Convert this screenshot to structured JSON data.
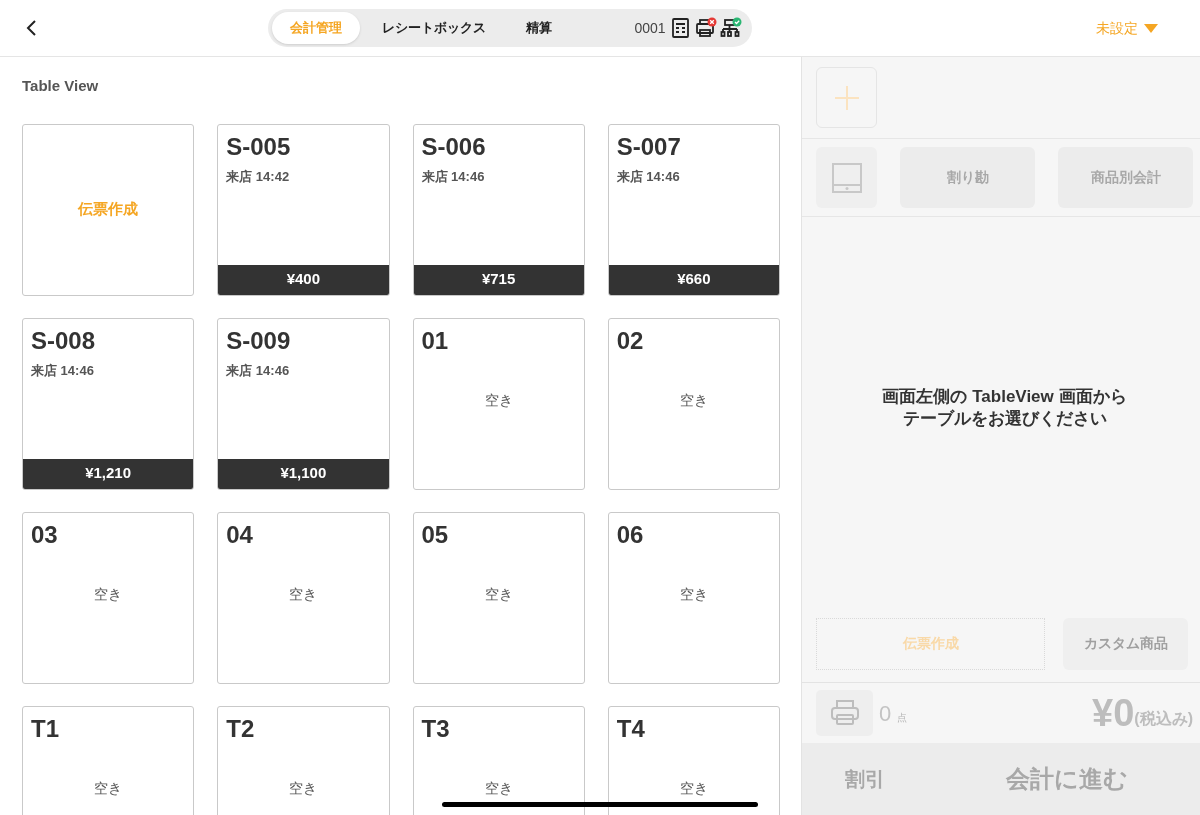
{
  "header": {
    "tabs": [
      {
        "label": "会計管理",
        "selected": true
      },
      {
        "label": "レシートボックス",
        "selected": false
      },
      {
        "label": "精算",
        "selected": false
      }
    ],
    "terminal_id": "0001",
    "status_icons": [
      {
        "kind": "calculator",
        "error": false,
        "ok": false
      },
      {
        "kind": "printer",
        "error": true,
        "ok": false
      },
      {
        "kind": "network",
        "error": false,
        "ok": true
      }
    ],
    "store_selector": "未設定"
  },
  "table_view": {
    "title": "Table View",
    "tables": [
      {
        "kind": "new",
        "label": "伝票作成"
      },
      {
        "kind": "occupied",
        "name": "S-005",
        "arrival": "来店 14:42",
        "amount": "¥400"
      },
      {
        "kind": "occupied",
        "name": "S-006",
        "arrival": "来店 14:46",
        "amount": "¥715"
      },
      {
        "kind": "occupied",
        "name": "S-007",
        "arrival": "来店 14:46",
        "amount": "¥660"
      },
      {
        "kind": "occupied",
        "name": "S-008",
        "arrival": "来店 14:46",
        "amount": "¥1,210"
      },
      {
        "kind": "occupied",
        "name": "S-009",
        "arrival": "来店 14:46",
        "amount": "¥1,100"
      },
      {
        "kind": "empty",
        "name": "01",
        "status": "空き"
      },
      {
        "kind": "empty",
        "name": "02",
        "status": "空き"
      },
      {
        "kind": "empty",
        "name": "03",
        "status": "空き"
      },
      {
        "kind": "empty",
        "name": "04",
        "status": "空き"
      },
      {
        "kind": "empty",
        "name": "05",
        "status": "空き"
      },
      {
        "kind": "empty",
        "name": "06",
        "status": "空き"
      },
      {
        "kind": "empty",
        "name": "T1",
        "status": "空き"
      },
      {
        "kind": "empty",
        "name": "T2",
        "status": "空き"
      },
      {
        "kind": "empty",
        "name": "T3",
        "status": "空き"
      },
      {
        "kind": "empty",
        "name": "T4",
        "status": "空き"
      }
    ]
  },
  "order_panel": {
    "actions": [
      {
        "label": "割り勘",
        "disabled": true
      },
      {
        "label": "商品別会計",
        "disabled": true
      }
    ],
    "message": [
      "画面左側の TableView 画面から",
      "テーブルをお選びください"
    ],
    "create_slip": "伝票作成",
    "custom_item": "カスタム商品",
    "count": "0",
    "count_unit": "点",
    "total": "¥0",
    "tax_note": "(税込み)",
    "discount": "割引",
    "checkout": "会計に進む"
  }
}
